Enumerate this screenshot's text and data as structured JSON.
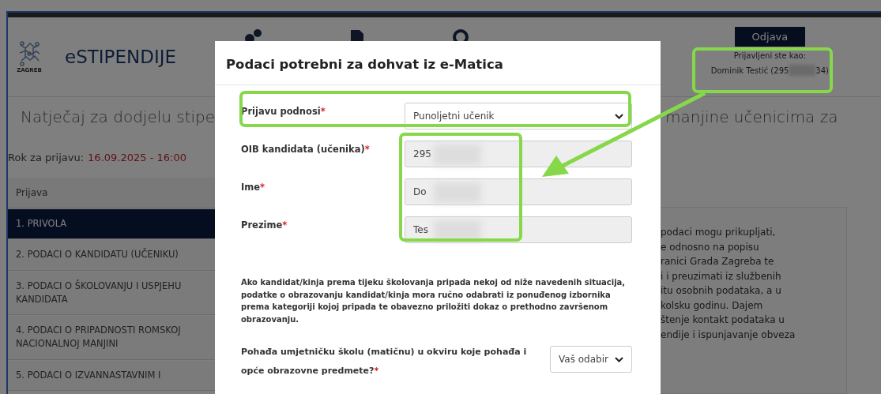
{
  "header": {
    "brand": "eSTIPENDIJE",
    "logo_caption": "ZAGREB",
    "logout_button": "Odjava",
    "logged_in_label": "Prijavljeni ste kao:",
    "user_prefix": "Dominik Testić (295",
    "user_suffix": "34)"
  },
  "page_title": {
    "left_part": "Natječaj za dodjelu stipe",
    "right_part": "manjine učenicima za"
  },
  "deadline": {
    "label": "Rok za prijavu:",
    "value": "16.09.2025 - 16:00"
  },
  "sidebar": {
    "heading": "Prijava",
    "items": [
      {
        "label": "1. PRIVOLA",
        "selected": true
      },
      {
        "label": "2. PODACI O KANDIDATU (UČENIKU)",
        "selected": false
      },
      {
        "label": "3. PODACI O ŠKOLOVANJU I USPJEHU KANDIDATA",
        "selected": false
      },
      {
        "label": "4. PODACI O PRIPADNOSTI ROMSKOJ NACIONALNOJ MANJINI",
        "selected": false
      },
      {
        "label": "5. PODACI O IZVANNASTAVNIM I",
        "selected": false
      }
    ]
  },
  "content_lines": [
    "podaci mogu prikupljati,",
    "e odnosno na popisu",
    "ranici Grada Zagreba te",
    "i i preuzimati iz službenih",
    "itu osobnih podataka, a u",
    "kolsku godinu. Dajem",
    "štenje kontakt podataka u",
    "endije i ispunjavanje obveza"
  ],
  "modal": {
    "title": "Podaci potrebni za dohvat iz e-Matica",
    "fields": [
      {
        "kind": "select",
        "label": "Prijavu podnosi",
        "required_mark": "*",
        "value": "Punoljetni učenik",
        "redacted": false
      },
      {
        "kind": "text",
        "label": "OIB kandidata (učenika)",
        "required_mark": "*",
        "value": "295",
        "redacted": true
      },
      {
        "kind": "text",
        "label": "Ime",
        "required_mark": "*",
        "value": "Do",
        "redacted": true
      },
      {
        "kind": "text",
        "label": "Prezime",
        "required_mark": "*",
        "value": "Tes",
        "redacted": true
      }
    ],
    "note": "Ako kandidat/kinja prema tijeku školovanja pripada nekoj od niže navedenih situacija, podatke o obrazovanju kandidat/kinja mora ručno odabrati iz ponuđenog izbornika prema kategoriji kojoj pripada te obavezno priložiti dokaz o prethodno završenom obrazovanju.",
    "questions": [
      {
        "label": "Pohađa umjetničku školu (matičnu) u okviru koje pohađa i opće obrazovne predmete?",
        "required_mark": "*",
        "value": "Vaš odabir"
      }
    ]
  }
}
